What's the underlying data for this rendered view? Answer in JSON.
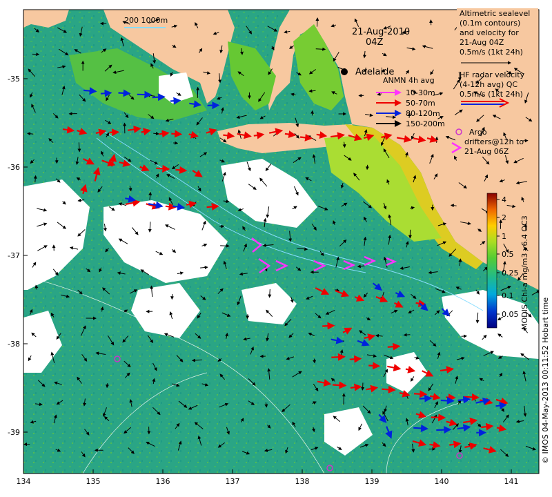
{
  "title_date": "21-Aug-2010",
  "title_time": "04Z",
  "scale_label": "200 1000m",
  "city": "Adelaide",
  "legends": {
    "altimetry": [
      "Altimetric sealevel",
      "(0.1m contours)",
      "and velocity for",
      "21-Aug 04Z",
      "0.5m/s (1kt 24h)"
    ],
    "hf_radar": [
      "HF radar velocity",
      "(4-12h avg) QC",
      "0.5m/s (1kt 24h)"
    ],
    "anmn": {
      "title": "ANMN 4h avg",
      "items": [
        {
          "label": "10-30m",
          "color": "#ff33ff"
        },
        {
          "label": "50-70m",
          "color": "#ee0000"
        },
        {
          "label": "80-120m",
          "color": "#0022dd"
        },
        {
          "label": "150-200m",
          "color": "#000000"
        }
      ]
    },
    "argo": [
      "Argo",
      "drifters@12h to",
      "21-Aug 06Z"
    ]
  },
  "colorbar": {
    "label": "MODIS Chl-a mg/m3 v6.4 OC3",
    "ticks": [
      "4",
      "2",
      "1",
      "0.5",
      "0.25",
      "0.1",
      "0.05"
    ]
  },
  "axes": {
    "x_ticks": [
      "134",
      "135",
      "136",
      "137",
      "138",
      "139",
      "140",
      "141"
    ],
    "y_ticks": [
      "-35",
      "-36",
      "-37",
      "-38",
      "-39"
    ]
  },
  "credit": "© IMOS 04-May-2013 00:11:52 Hobart time",
  "colors": {
    "land": "#f7c8a0",
    "chl_low": "#22aa88",
    "chl_mid": "#44bb44",
    "chl_high": "#bbdd22",
    "coast_high": "#ee9922",
    "cloud": "#ffffff"
  }
}
